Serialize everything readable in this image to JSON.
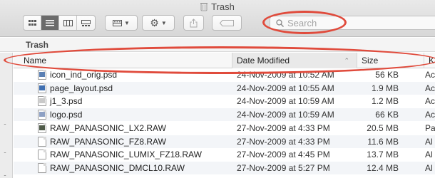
{
  "window": {
    "title": "Trash"
  },
  "toolbar": {
    "search_placeholder": "Search"
  },
  "path": {
    "label": "Trash"
  },
  "columns": {
    "name": "Name",
    "date": "Date Modified",
    "size": "Size",
    "kind": "K"
  },
  "files": [
    {
      "name": "icon_ind_orig.psd",
      "date": "24-Nov-2009 at 10:52 AM",
      "size": "56 KB",
      "kind": "Ac",
      "icon": "psd-file-icon",
      "pic_color": "#5a7fb3"
    },
    {
      "name": "page_layout.psd",
      "date": "24-Nov-2009 at 10:55 AM",
      "size": "1.9 MB",
      "kind": "Ac",
      "icon": "psd-file-icon",
      "pic_color": "#3f6fb1"
    },
    {
      "name": "j1_3.psd",
      "date": "24-Nov-2009 at 10:59 AM",
      "size": "1.2 MB",
      "kind": "Ac",
      "icon": "psd-file-icon",
      "pic_color": "#c9c9c9"
    },
    {
      "name": "logo.psd",
      "date": "24-Nov-2009 at 10:59 AM",
      "size": "66 KB",
      "kind": "Ac",
      "icon": "psd-file-icon",
      "pic_color": "#8da0c4"
    },
    {
      "name": "RAW_PANASONIC_LX2.RAW",
      "date": "27-Nov-2009 at 4:33 PM",
      "size": "20.5 MB",
      "kind": "Pa",
      "icon": "raw-image-icon",
      "pic_color": "#4e5a48"
    },
    {
      "name": "RAW_PANASONIC_FZ8.RAW",
      "date": "27-Nov-2009 at 4:33 PM",
      "size": "11.6 MB",
      "kind": "Al",
      "icon": "document-icon",
      "pic_color": ""
    },
    {
      "name": "RAW_PANASONIC_LUMIX_FZ18.RAW",
      "date": "27-Nov-2009 at 4:45 PM",
      "size": "13.7 MB",
      "kind": "Al",
      "icon": "document-icon",
      "pic_color": ""
    },
    {
      "name": "RAW_PANASONIC_DMCL10.RAW",
      "date": "27-Nov-2009 at 5:27 PM",
      "size": "12.4 MB",
      "kind": "Al",
      "icon": "document-icon",
      "pic_color": ""
    }
  ],
  "annotations": {
    "color": "#e04b3c"
  }
}
